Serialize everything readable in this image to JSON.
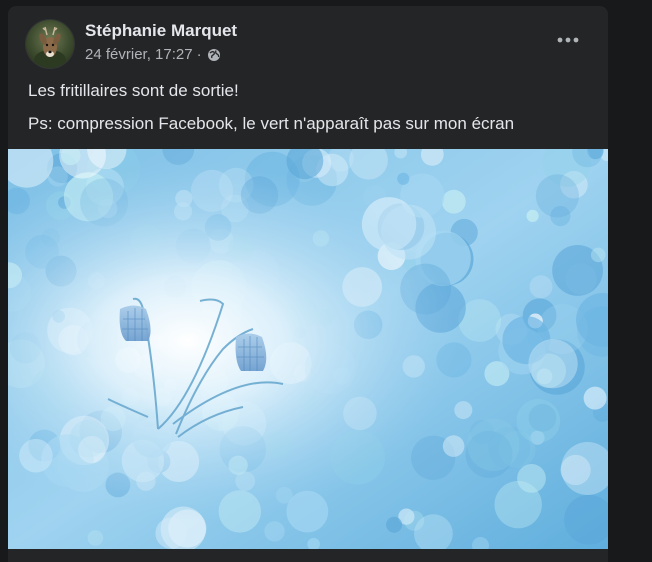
{
  "post": {
    "author": "Stéphanie Marquet",
    "date": "24 février, 17:27",
    "separator": "·",
    "privacy_icon": "globe-icon",
    "more_icon": "more-options-icon",
    "lines": [
      "Les fritillaires sont de sortie!",
      "Ps: compression Facebook, le vert n'apparaît pas sur mon écran"
    ],
    "avatar_icon": "deer-avatar",
    "photo_icon": "fritillary-flowers-bokeh-photo"
  },
  "colors": {
    "page_bg": "#18191a",
    "card_bg": "#242526",
    "primary_text": "#e4e6eb",
    "secondary_text": "#b0b3b8",
    "photo_blue": "#8dc7ea"
  }
}
